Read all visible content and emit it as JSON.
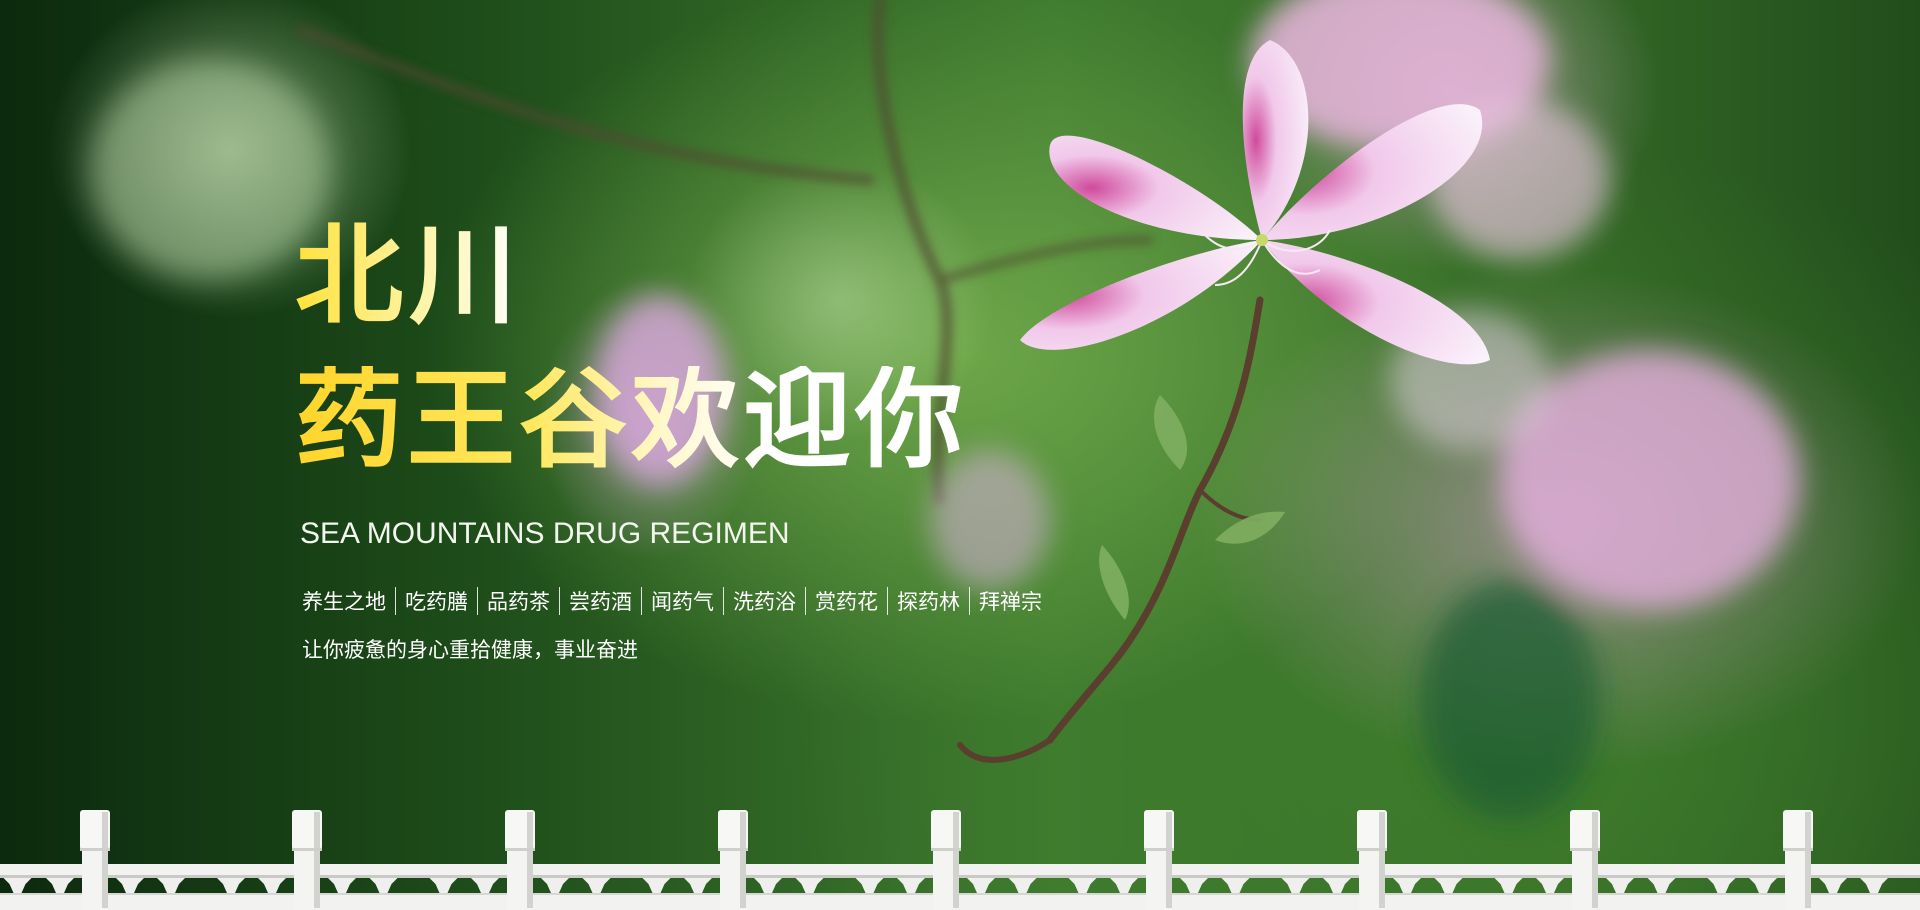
{
  "headline": {
    "line1": "北川",
    "line2": "药王谷欢迎你"
  },
  "subtitle": "SEA MOUNTAINS DRUG REGIMEN",
  "nav_items": [
    "养生之地",
    "吃药膳",
    "品药茶",
    "尝药酒",
    "闻药气",
    "洗药浴",
    "赏药花",
    "探药林",
    "拜禅宗"
  ],
  "slogan": "让你疲惫的身心重拾健康，事业奋进",
  "colors": {
    "headline_yellow": "#ffe23a",
    "text_white": "#ffffff",
    "fence_white": "#f2f2f0",
    "foliage_green": "#3f7b2f",
    "blossom_pink": "#e6b6e0"
  },
  "icons": [
    "orchid-flower",
    "tree-branch",
    "white-stone-fence"
  ]
}
